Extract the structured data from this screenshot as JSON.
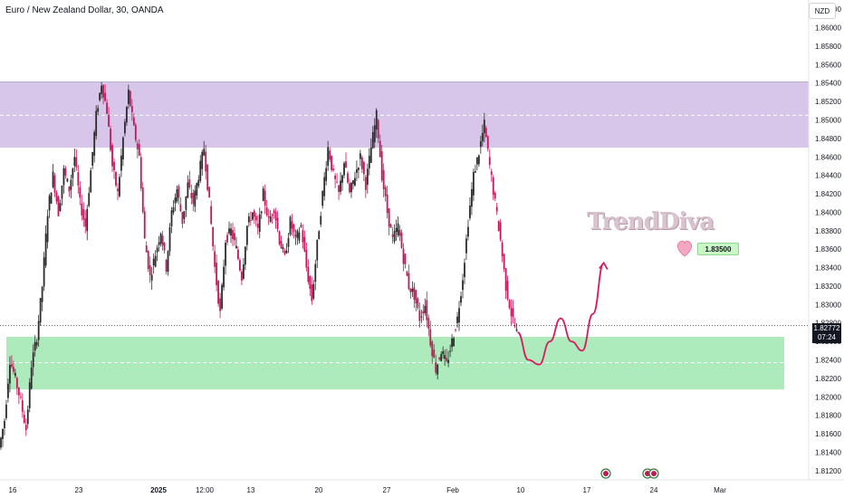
{
  "header": {
    "symbol_title": "Euro / New Zealand Dollar, 30, OANDA",
    "currency": "NZD"
  },
  "price_scale": {
    "labels": [
      "1.86200",
      "1.86000",
      "1.85800",
      "1.85600",
      "1.85400",
      "1.85200",
      "1.85000",
      "1.84800",
      "1.84600",
      "1.84400",
      "1.84200",
      "1.84000",
      "1.83800",
      "1.83600",
      "1.83400",
      "1.83200",
      "1.83000",
      "1.82800",
      "1.82600",
      "1.82400",
      "1.82200",
      "1.82000",
      "1.81800",
      "1.81600",
      "1.81400",
      "1.81200"
    ],
    "current_price": "1.82772",
    "countdown": "07:24"
  },
  "time_scale": {
    "labels": [
      "16",
      "23",
      "2025",
      "12:00",
      "13",
      "20",
      "27",
      "Feb",
      "10",
      "17",
      "24",
      "Mar"
    ]
  },
  "annotations": {
    "target_label": "1.83500",
    "watermark": "TrendDiva"
  },
  "colors": {
    "resistance_zone": "#c9b3e3",
    "support_zone": "#9fe6b0",
    "candle_up": "#2b2b2b",
    "candle_down": "#c2185b",
    "projection": "#d81b60"
  },
  "chart_data": {
    "type": "candlestick",
    "ylim": [
      1.811,
      1.863
    ],
    "price_ticks": [
      1.862,
      1.86,
      1.858,
      1.856,
      1.854,
      1.852,
      1.85,
      1.848,
      1.846,
      1.844,
      1.842,
      1.84,
      1.838,
      1.836,
      1.834,
      1.832,
      1.83,
      1.828,
      1.826,
      1.824,
      1.822,
      1.82,
      1.818,
      1.816,
      1.814,
      1.812
    ],
    "zones": [
      {
        "name": "resistance",
        "top": 1.8541,
        "bottom": 1.847,
        "mid": 1.8505
      },
      {
        "name": "support",
        "top": 1.8265,
        "bottom": 1.8208,
        "mid": 1.8237
      }
    ],
    "current_price": 1.82772,
    "target_price": 1.835,
    "price_path": [
      [
        0,
        1.8145
      ],
      [
        2,
        1.8175
      ],
      [
        4,
        1.824
      ],
      [
        6,
        1.822
      ],
      [
        8,
        1.8195
      ],
      [
        10,
        1.8165
      ],
      [
        12,
        1.8235
      ],
      [
        14,
        1.8265
      ],
      [
        16,
        1.832
      ],
      [
        18,
        1.84
      ],
      [
        20,
        1.844
      ],
      [
        22,
        1.84
      ],
      [
        24,
        1.8445
      ],
      [
        26,
        1.8425
      ],
      [
        28,
        1.846
      ],
      [
        30,
        1.841
      ],
      [
        32,
        1.8385
      ],
      [
        34,
        1.8445
      ],
      [
        36,
        1.8505
      ],
      [
        38,
        1.854
      ],
      [
        40,
        1.851
      ],
      [
        42,
        1.845
      ],
      [
        44,
        1.842
      ],
      [
        46,
        1.848
      ],
      [
        48,
        1.853
      ],
      [
        50,
        1.849
      ],
      [
        52,
        1.846
      ],
      [
        54,
        1.837
      ],
      [
        56,
        1.833
      ],
      [
        58,
        1.8355
      ],
      [
        60,
        1.838
      ],
      [
        62,
        1.834
      ],
      [
        64,
        1.84
      ],
      [
        66,
        1.8425
      ],
      [
        68,
        1.839
      ],
      [
        70,
        1.843
      ],
      [
        72,
        1.841
      ],
      [
        74,
        1.844
      ],
      [
        76,
        1.847
      ],
      [
        78,
        1.841
      ],
      [
        80,
        1.834
      ],
      [
        82,
        1.829
      ],
      [
        84,
        1.837
      ],
      [
        86,
        1.838
      ],
      [
        88,
        1.836
      ],
      [
        90,
        1.833
      ],
      [
        92,
        1.8385
      ],
      [
        94,
        1.84
      ],
      [
        96,
        1.838
      ],
      [
        98,
        1.842
      ],
      [
        100,
        1.839
      ],
      [
        102,
        1.8405
      ],
      [
        104,
        1.837
      ],
      [
        106,
        1.835
      ],
      [
        108,
        1.839
      ],
      [
        110,
        1.837
      ],
      [
        112,
        1.8385
      ],
      [
        114,
        1.834
      ],
      [
        116,
        1.8305
      ],
      [
        118,
        1.8365
      ],
      [
        120,
        1.842
      ],
      [
        122,
        1.847
      ],
      [
        124,
        1.844
      ],
      [
        126,
        1.842
      ],
      [
        128,
        1.8455
      ],
      [
        130,
        1.842
      ],
      [
        132,
        1.844
      ],
      [
        134,
        1.846
      ],
      [
        136,
        1.843
      ],
      [
        138,
        1.847
      ],
      [
        140,
        1.8505
      ],
      [
        142,
        1.844
      ],
      [
        144,
        1.84
      ],
      [
        146,
        1.837
      ],
      [
        148,
        1.8385
      ],
      [
        150,
        1.835
      ],
      [
        152,
        1.832
      ],
      [
        154,
        1.831
      ],
      [
        156,
        1.8285
      ],
      [
        158,
        1.83
      ],
      [
        160,
        1.826
      ],
      [
        162,
        1.823
      ],
      [
        164,
        1.825
      ],
      [
        166,
        1.8235
      ],
      [
        168,
        1.826
      ],
      [
        170,
        1.8285
      ],
      [
        172,
        1.833
      ],
      [
        174,
        1.839
      ],
      [
        176,
        1.844
      ],
      [
        178,
        1.8465
      ],
      [
        180,
        1.8495
      ],
      [
        182,
        1.845
      ],
      [
        184,
        1.841
      ],
      [
        186,
        1.837
      ],
      [
        188,
        1.832
      ],
      [
        190,
        1.829
      ],
      [
        192,
        1.827
      ]
    ],
    "projection_path": [
      [
        192,
        1.827
      ],
      [
        196,
        1.824
      ],
      [
        200,
        1.8235
      ],
      [
        204,
        1.826
      ],
      [
        208,
        1.8285
      ],
      [
        212,
        1.826
      ],
      [
        216,
        1.825
      ],
      [
        220,
        1.829
      ],
      [
        224,
        1.8345
      ]
    ]
  }
}
